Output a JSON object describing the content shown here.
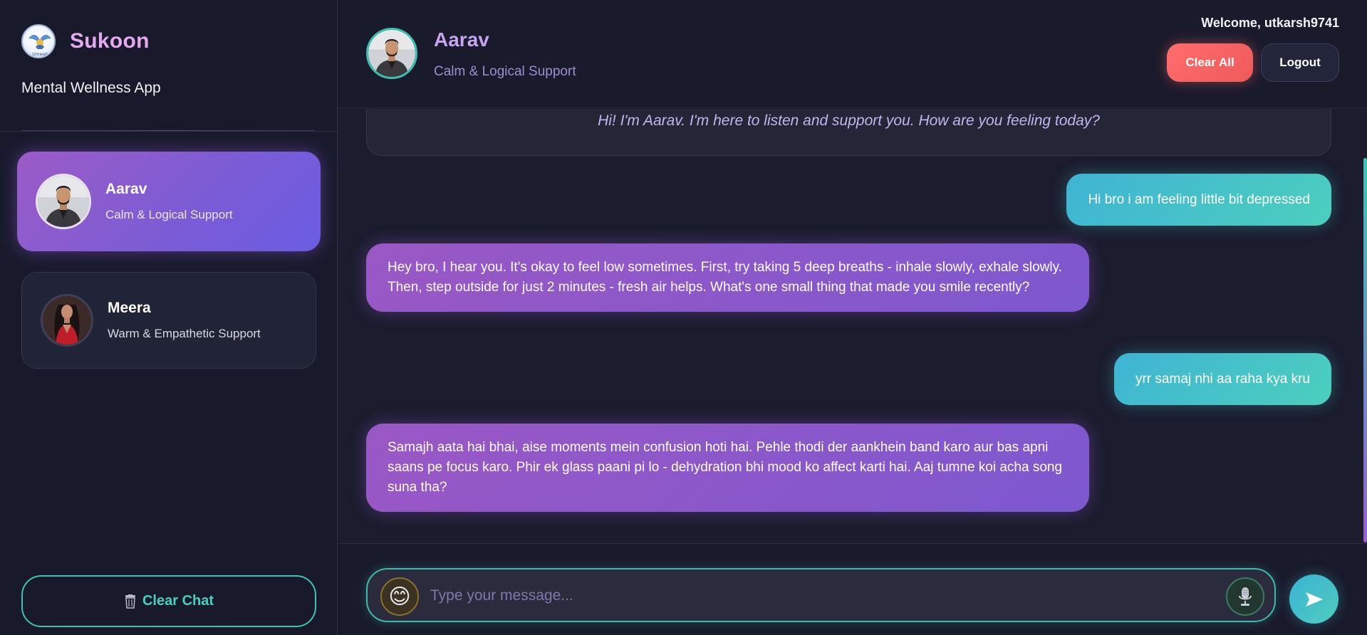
{
  "brand": {
    "name": "Sukoon",
    "logo_text": "Umeed",
    "subtitle": "Mental Wellness App"
  },
  "sidebar": {
    "agents": [
      {
        "name": "Aarav",
        "description": "Calm & Logical Support",
        "active": true
      },
      {
        "name": "Meera",
        "description": "Warm & Empathetic Support",
        "active": false
      }
    ],
    "clear_chat_label": "Clear Chat",
    "clear_chat_icon": "trash-icon"
  },
  "header": {
    "agent_name": "Aarav",
    "agent_description": "Calm & Logical Support",
    "welcome": "Welcome, utkarsh9741",
    "clear_all_label": "Clear All",
    "logout_label": "Logout"
  },
  "chat": {
    "greeting": "Hi! I'm Aarav. I'm here to listen and support you. How are you feeling today?",
    "messages": [
      {
        "role": "user",
        "text": "Hi bro i am feeling little bit depressed"
      },
      {
        "role": "bot",
        "text": "Hey bro, I hear you. It's okay to feel low sometimes. First, try taking 5 deep breaths - inhale slowly, exhale slowly. Then, step outside for just 2 minutes - fresh air helps. What's one small thing that made you smile recently?"
      },
      {
        "role": "user",
        "text": "yrr samaj nhi aa raha kya kru"
      },
      {
        "role": "bot",
        "text": "Samajh aata hai bhai, aise moments mein confusion hoti hai. Pehle thodi der aankhein band karo aur bas apni saans pe focus karo. Phir ek glass paani pi lo - dehydration bhi mood ko affect karti hai. Aaj tumne koi acha song suna tha?"
      }
    ]
  },
  "composer": {
    "placeholder": "Type your message...",
    "emoji": "😊",
    "mic_icon": "microphone-icon",
    "send_icon": "send-icon"
  },
  "colors": {
    "accent_purple": "#8a5ad0",
    "accent_teal": "#47cfc0",
    "danger": "#ff6d6d",
    "brand_pink": "#e4a9ef"
  }
}
